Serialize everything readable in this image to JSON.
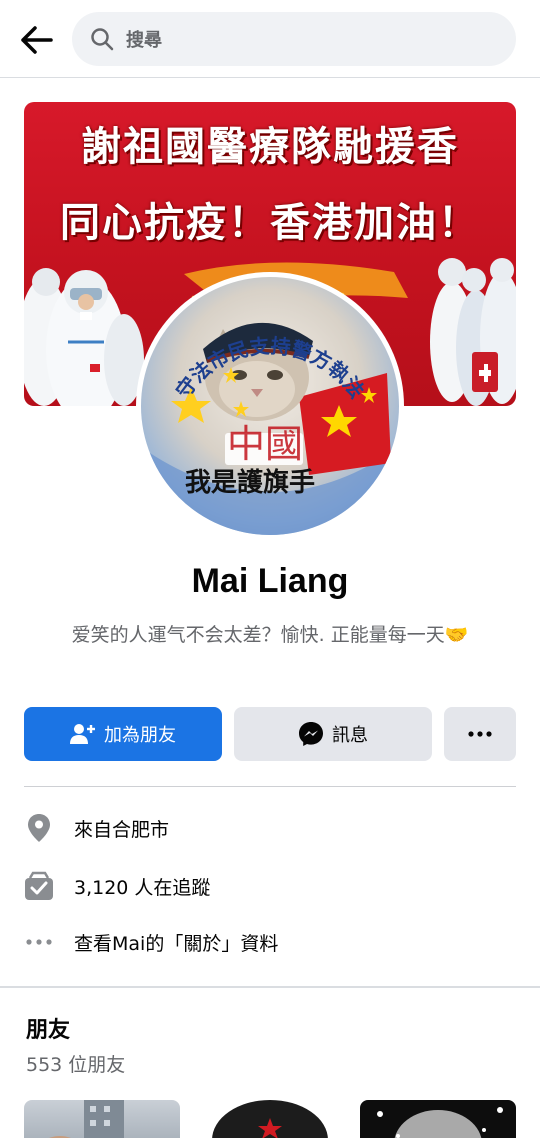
{
  "search": {
    "placeholder": "搜尋"
  },
  "cover": {
    "line1": "謝祖國醫療隊馳援香",
    "line2": "同心抗疫！香港加油！"
  },
  "avatar": {
    "arc_text": "守法市民支持警方執法",
    "center_text": "中國",
    "bottom_text": "我是護旗手"
  },
  "profile": {
    "name": "Mai Liang",
    "bio": "爱笑的人運气不会太差？愉快. 正能量每一天🤝"
  },
  "actions": {
    "add_friend": "加為朋友",
    "message": "訊息",
    "more": "•••"
  },
  "info": {
    "location": "來自合肥市",
    "followers": "3,120 人在追蹤",
    "about": "查看Mai的「關於」資料"
  },
  "friends": {
    "title": "朋友",
    "count": "553 位朋友"
  },
  "colors": {
    "primary": "#1b74e4",
    "secondary_bg": "#e4e6eb",
    "cover_red": "#c4121f"
  },
  "icons": {
    "back": "arrow-left-icon",
    "search": "search-icon",
    "add_friend": "add-friend-icon",
    "messenger": "messenger-icon",
    "more": "more-icon",
    "location": "location-pin-icon",
    "followers": "followers-icon",
    "about": "ellipsis-icon"
  }
}
